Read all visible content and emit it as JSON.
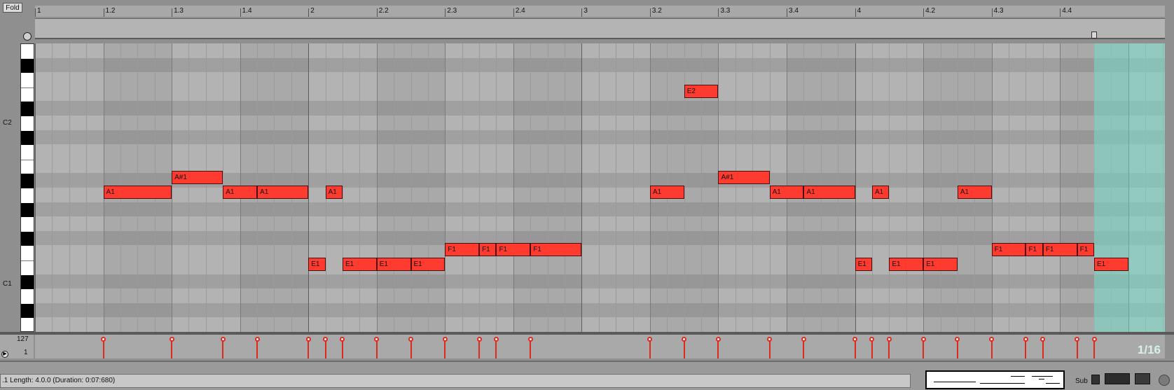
{
  "fold_button": {
    "label": "Fold"
  },
  "ruler": {
    "labels": [
      "1",
      "1.2",
      "1.3",
      "1.4",
      "2",
      "2.2",
      "2.3",
      "2.4",
      "3",
      "3.2",
      "3.3",
      "3.4",
      "4",
      "4.2",
      "4.3",
      "4.4"
    ]
  },
  "keyboard": {
    "octave_labels": [
      "C2",
      "C1"
    ]
  },
  "notes": [
    {
      "pitch": "A1",
      "start": 1.0,
      "length": 1.0
    },
    {
      "pitch": "A#1",
      "start": 2.0,
      "length": 0.75
    },
    {
      "pitch": "A1",
      "start": 2.75,
      "length": 0.5
    },
    {
      "pitch": "A1",
      "start": 3.25,
      "length": 0.75
    },
    {
      "pitch": "E1",
      "start": 4.0,
      "length": 0.25
    },
    {
      "pitch": "A1",
      "start": 4.25,
      "length": 0.25
    },
    {
      "pitch": "E1",
      "start": 4.5,
      "length": 0.5
    },
    {
      "pitch": "E1",
      "start": 5.0,
      "length": 0.5
    },
    {
      "pitch": "E1",
      "start": 5.5,
      "length": 0.5
    },
    {
      "pitch": "F1",
      "start": 6.0,
      "length": 0.5
    },
    {
      "pitch": "F1",
      "start": 6.5,
      "length": 0.25
    },
    {
      "pitch": "F1",
      "start": 6.75,
      "length": 0.5
    },
    {
      "pitch": "F1",
      "start": 7.25,
      "length": 0.75
    },
    {
      "pitch": "A1",
      "start": 9.0,
      "length": 0.5
    },
    {
      "pitch": "E2",
      "start": 9.5,
      "length": 0.5
    },
    {
      "pitch": "A#1",
      "start": 10.0,
      "length": 0.75
    },
    {
      "pitch": "A1",
      "start": 10.75,
      "length": 0.5
    },
    {
      "pitch": "A1",
      "start": 11.25,
      "length": 0.75
    },
    {
      "pitch": "E1",
      "start": 12.0,
      "length": 0.25
    },
    {
      "pitch": "A1",
      "start": 12.25,
      "length": 0.25
    },
    {
      "pitch": "E1",
      "start": 12.5,
      "length": 0.5
    },
    {
      "pitch": "E1",
      "start": 13.0,
      "length": 0.5
    },
    {
      "pitch": "A1",
      "start": 13.5,
      "length": 0.5
    },
    {
      "pitch": "F1",
      "start": 14.0,
      "length": 0.5
    },
    {
      "pitch": "F1",
      "start": 14.5,
      "length": 0.25
    },
    {
      "pitch": "F1",
      "start": 14.75,
      "length": 0.5
    },
    {
      "pitch": "F1",
      "start": 15.25,
      "length": 0.25
    },
    {
      "pitch": "E1",
      "start": 15.5,
      "length": 0.5
    }
  ],
  "velocity": {
    "max_label": "127",
    "min_label": "1"
  },
  "grid_readout": "1/16",
  "status": {
    "text": ".1   Length: 4.0.0  (Duration: 0:07:680)"
  },
  "bottom_right": {
    "sub_label": "Sub"
  }
}
